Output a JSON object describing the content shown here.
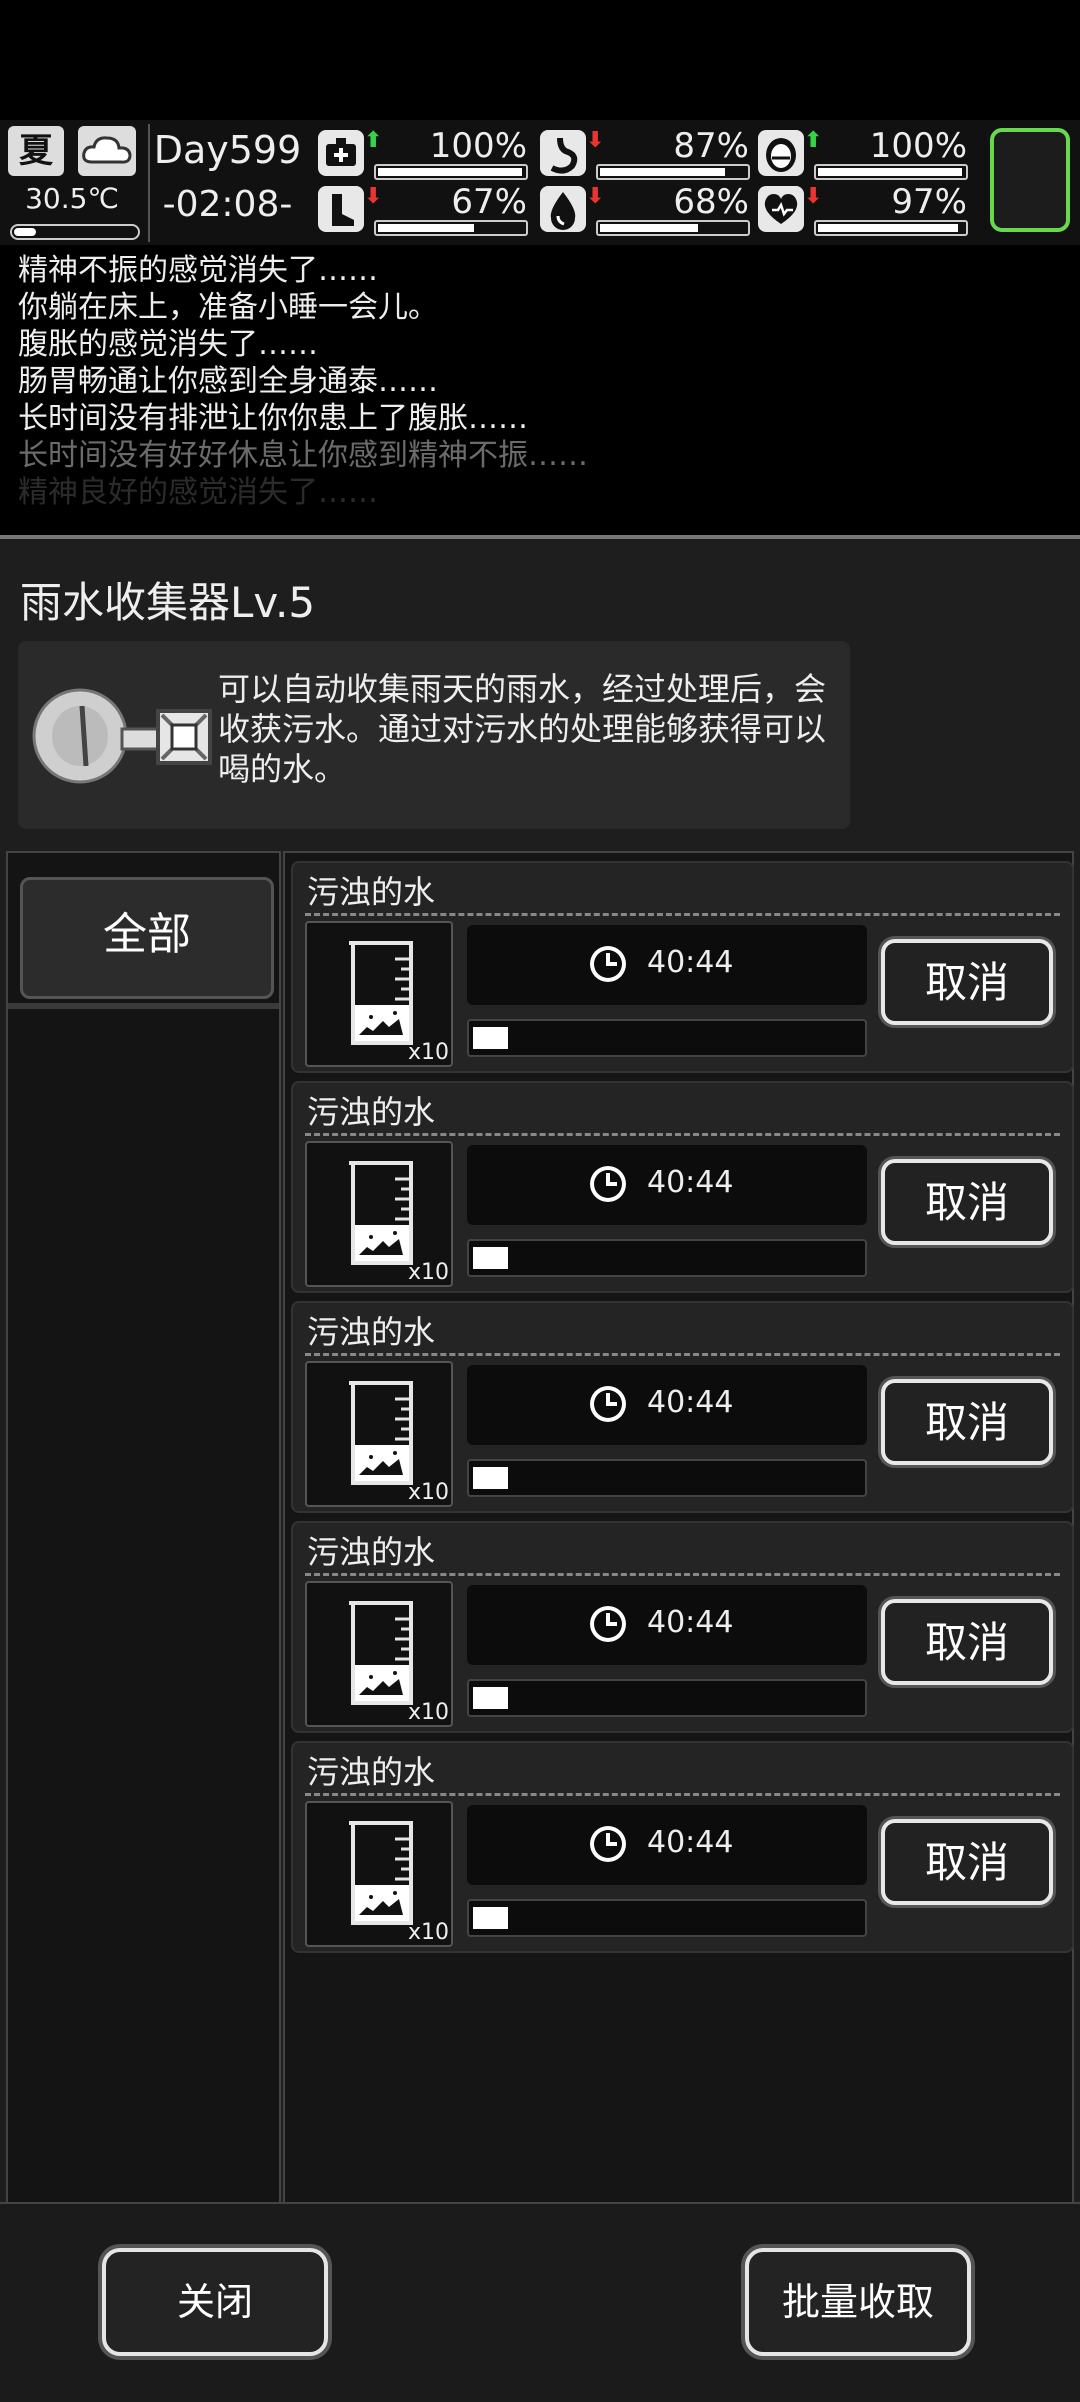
{
  "status": {
    "season": "夏",
    "temperature": "30.5℃",
    "day": "Day599",
    "time": "-02:08-",
    "stats": [
      {
        "name": "health-icon",
        "value": "100%",
        "fraction": 1.0,
        "trend": "up"
      },
      {
        "name": "stomach-icon",
        "value": "87%",
        "fraction": 0.87,
        "trend": "down"
      },
      {
        "name": "bladder-icon",
        "value": "100%",
        "fraction": 1.0,
        "trend": "up"
      },
      {
        "name": "stamina-icon",
        "value": "67%",
        "fraction": 0.67,
        "trend": "down"
      },
      {
        "name": "water-drop-icon",
        "value": "68%",
        "fraction": 0.68,
        "trend": "down"
      },
      {
        "name": "heart-icon",
        "value": "97%",
        "fraction": 0.97,
        "trend": "down"
      }
    ],
    "colors": {
      "up": "#34d349",
      "down": "#e8352f",
      "slot_border": "#6ad84f"
    }
  },
  "log": [
    "精神不振的感觉消失了……",
    "你躺在床上，准备小睡一会儿。",
    "腹胀的感觉消失了……",
    "肠胃畅通让你感到全身通泰……",
    "长时间没有排泄让你你患上了腹胀……",
    "长时间没有好好休息让你感到精神不振……",
    "精神良好的感觉消失了……"
  ],
  "panel": {
    "title": "雨水收集器Lv.5",
    "description": "可以自动收集雨天的雨水，经过处理后，会收获污水。通过对污水的处理能够获得可以喝的水。",
    "filter_all": "全部",
    "items": [
      {
        "name": "污浊的水",
        "qty": "x10",
        "time": "40:44",
        "progress": 0.09,
        "cancel": "取消"
      },
      {
        "name": "污浊的水",
        "qty": "x10",
        "time": "40:44",
        "progress": 0.09,
        "cancel": "取消"
      },
      {
        "name": "污浊的水",
        "qty": "x10",
        "time": "40:44",
        "progress": 0.09,
        "cancel": "取消"
      },
      {
        "name": "污浊的水",
        "qty": "x10",
        "time": "40:44",
        "progress": 0.09,
        "cancel": "取消"
      },
      {
        "name": "污浊的水",
        "qty": "x10",
        "time": "40:44",
        "progress": 0.09,
        "cancel": "取消"
      }
    ]
  },
  "buttons": {
    "close": "关闭",
    "collect_all": "批量收取"
  }
}
